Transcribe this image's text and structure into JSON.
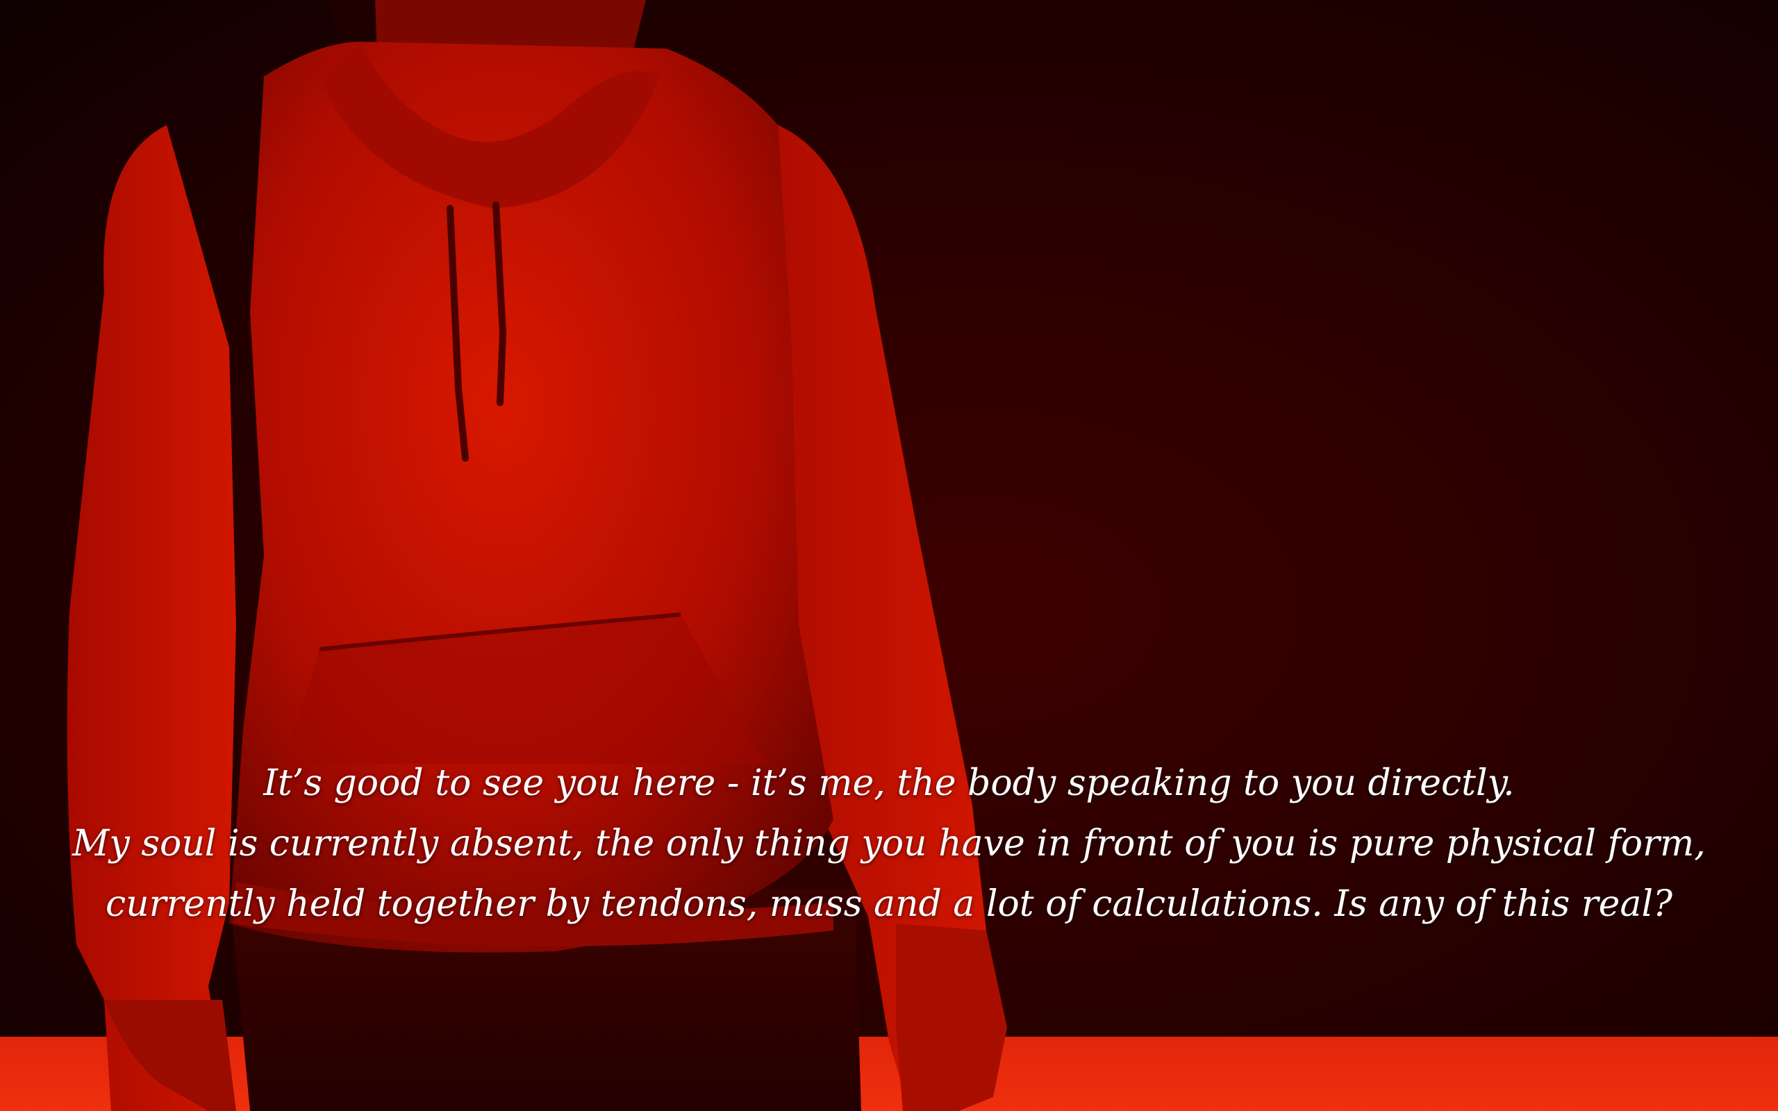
{
  "scene": {
    "background_color": "#2a0000",
    "floor_color": "#e8290b",
    "figure_color": "#c81000"
  },
  "dialogue": {
    "lines": [
      "It’s good to see you here - it’s me, the body speaking to you directly.",
      "My soul is currently absent, the only thing you have in front of you is pure physical form,",
      "currently held together by tendons, mass and a lot of calculations. Is any of this real?"
    ]
  }
}
